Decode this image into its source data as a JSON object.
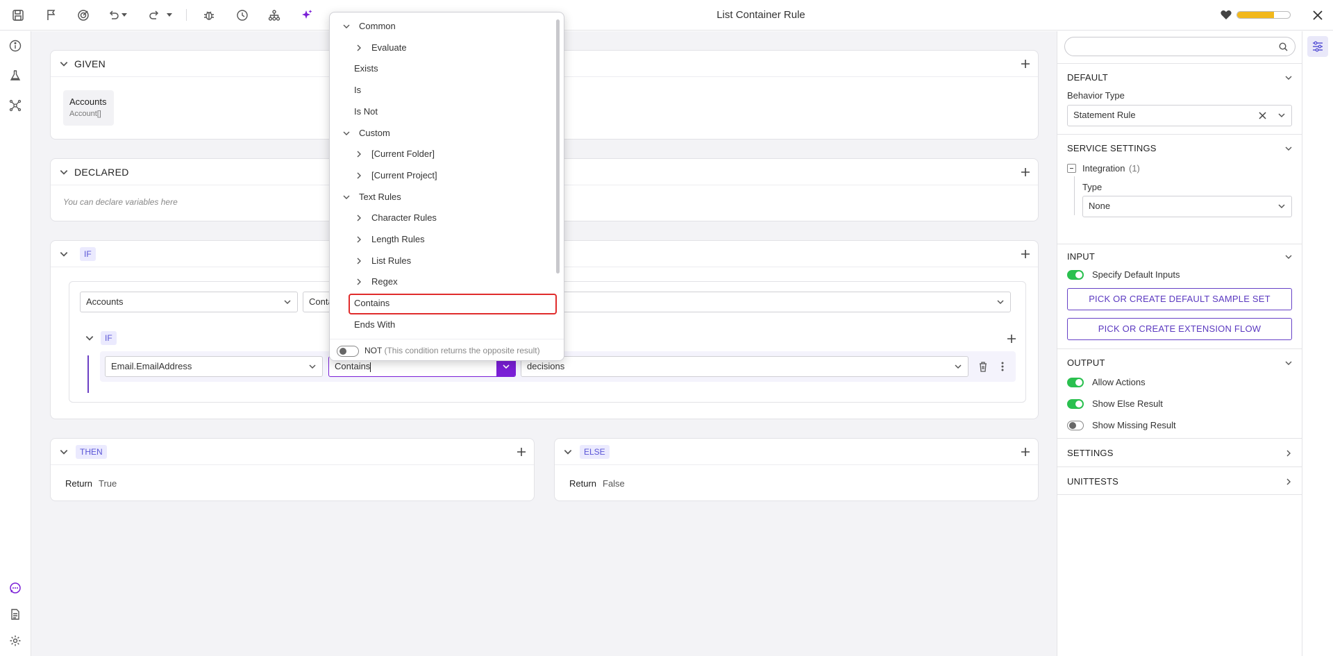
{
  "topbar": {
    "title": "List Container Rule",
    "icons": [
      "save-icon",
      "flag-icon",
      "target-icon",
      "undo-icon",
      "redo-icon",
      "bug-icon",
      "history-icon",
      "hierarchy-icon",
      "sparkle-icon",
      "heart-icon",
      "close-icon"
    ],
    "progress_fraction": 0.7
  },
  "left_rail": {
    "icons": [
      "info-icon",
      "flask-icon",
      "network-icon",
      "chat-icon",
      "document-icon",
      "settings-icon"
    ]
  },
  "given": {
    "label": "GIVEN",
    "item": {
      "name": "Accounts",
      "type": "Account[]"
    }
  },
  "declared": {
    "label": "DECLARED",
    "placeholder": "You can declare variables here"
  },
  "if_block": {
    "tag": "IF",
    "row1": {
      "left": "Accounts",
      "op": "Conta"
    },
    "inner": {
      "tag": "IF",
      "left": "Email.EmailAddress",
      "op": "Contains",
      "right": "decisions"
    }
  },
  "then_block": {
    "tag": "THEN",
    "return_label": "Return",
    "return_value": "True"
  },
  "else_block": {
    "tag": "ELSE",
    "return_label": "Return",
    "return_value": "False"
  },
  "menu": {
    "items": [
      {
        "label": "Common",
        "kind": "group-open",
        "indent": 0
      },
      {
        "label": "Evaluate",
        "kind": "group-closed",
        "indent": 1
      },
      {
        "label": "Exists",
        "kind": "leaf",
        "indent": 0
      },
      {
        "label": "Is",
        "kind": "leaf",
        "indent": 0
      },
      {
        "label": "Is Not",
        "kind": "leaf",
        "indent": 0
      },
      {
        "label": "Custom",
        "kind": "group-open",
        "indent": 0
      },
      {
        "label": "[Current Folder]",
        "kind": "group-closed",
        "indent": 1
      },
      {
        "label": "[Current Project]",
        "kind": "group-closed",
        "indent": 1
      },
      {
        "label": "Text Rules",
        "kind": "group-open",
        "indent": 0
      },
      {
        "label": "Character Rules",
        "kind": "group-closed",
        "indent": 1
      },
      {
        "label": "Length Rules",
        "kind": "group-closed",
        "indent": 1
      },
      {
        "label": "List Rules",
        "kind": "group-closed",
        "indent": 1
      },
      {
        "label": "Regex",
        "kind": "group-closed",
        "indent": 1
      },
      {
        "label": "Contains",
        "kind": "leaf-selected",
        "indent": 0
      },
      {
        "label": "Ends With",
        "kind": "leaf",
        "indent": 0
      }
    ],
    "not_label": "NOT",
    "not_hint": "(This condition returns the opposite result)",
    "not_enabled": false
  },
  "panel": {
    "search_placeholder": "",
    "default": {
      "title": "DEFAULT",
      "field_label": "Behavior Type",
      "value": "Statement Rule"
    },
    "service": {
      "title": "SERVICE SETTINGS",
      "integration": "Integration",
      "count": "(1)",
      "type_label": "Type",
      "type_value": "None"
    },
    "input": {
      "title": "INPUT",
      "toggle_label": "Specify Default Inputs",
      "toggle_on": true,
      "btn1": "PICK OR CREATE DEFAULT SAMPLE SET",
      "btn2": "PICK OR CREATE EXTENSION FLOW"
    },
    "output": {
      "title": "OUTPUT",
      "toggles": [
        {
          "label": "Allow Actions",
          "on": true
        },
        {
          "label": "Show Else Result",
          "on": true
        },
        {
          "label": "Show Missing Result",
          "on": false
        }
      ]
    },
    "settings": {
      "title": "SETTINGS"
    },
    "unittests": {
      "title": "UNITTESTS"
    }
  },
  "colors": {
    "accent": "#7a1fd6",
    "tag_bg": "#ebeafe",
    "tag_text": "#5a55d6",
    "toggle_on": "#2ac04f",
    "highlight": "#e02b2b",
    "progress": "#f2b81c"
  }
}
